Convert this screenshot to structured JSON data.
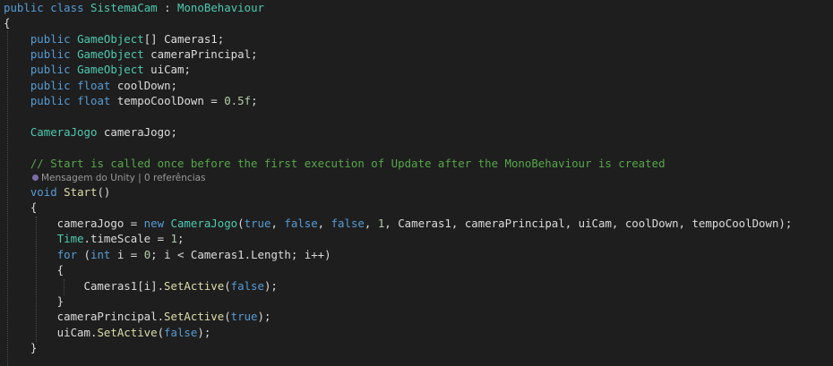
{
  "editor": {
    "lines": [
      [
        "public",
        " ",
        "class",
        " ",
        "SistemaCam",
        " : ",
        "MonoBehaviour"
      ],
      [
        "{"
      ],
      [
        "    ",
        "public",
        " ",
        "GameObject",
        "[] Cameras1;"
      ],
      [
        "    ",
        "public",
        " ",
        "GameObject",
        " cameraPrincipal;"
      ],
      [
        "    ",
        "public",
        " ",
        "GameObject",
        " uiCam;"
      ],
      [
        "    ",
        "public",
        " ",
        "float",
        " coolDown;"
      ],
      [
        "    ",
        "public",
        " ",
        "float",
        " tempoCoolDown = ",
        "0.5f",
        ";"
      ],
      [
        ""
      ],
      [
        "    ",
        "CameraJogo",
        " cameraJogo;"
      ],
      [
        ""
      ],
      [
        "    ",
        "// Start is called once before the first execution of Update after the MonoBehaviour is created"
      ],
      [
        "    ",
        "void",
        " ",
        "Start",
        "()"
      ],
      [
        "    {"
      ],
      [
        "        cameraJogo = ",
        "new",
        " ",
        "CameraJogo",
        "(",
        "true",
        ", ",
        "false",
        ", ",
        "false",
        ", ",
        "1",
        ", Cameras1, cameraPrincipal, uiCam, coolDown, tempoCoolDown);"
      ],
      [
        "        ",
        "Time",
        ".timeScale = ",
        "1",
        ";"
      ],
      [
        "        ",
        "for",
        " (",
        "int",
        " i = ",
        "0",
        "; i < Cameras1.Length; i++)"
      ],
      [
        "        {"
      ],
      [
        "            Cameras1[i].",
        "SetActive",
        "(",
        "false",
        ");"
      ],
      [
        "        }"
      ],
      [
        "        cameraPrincipal.",
        "SetActive",
        "(",
        "true",
        ");"
      ],
      [
        "        uiCam.",
        "SetActive",
        "(",
        "false",
        ");"
      ],
      [
        "    }"
      ]
    ],
    "codelens": "Mensagem do Unity | 0 referências",
    "colors": {
      "background": "#1e1e1e",
      "text": "#dcdcdc",
      "keyword": "#569cd6",
      "type": "#4ec9b0",
      "method": "#dcdcaa",
      "number": "#b5cea8",
      "comment": "#57a64a"
    }
  }
}
